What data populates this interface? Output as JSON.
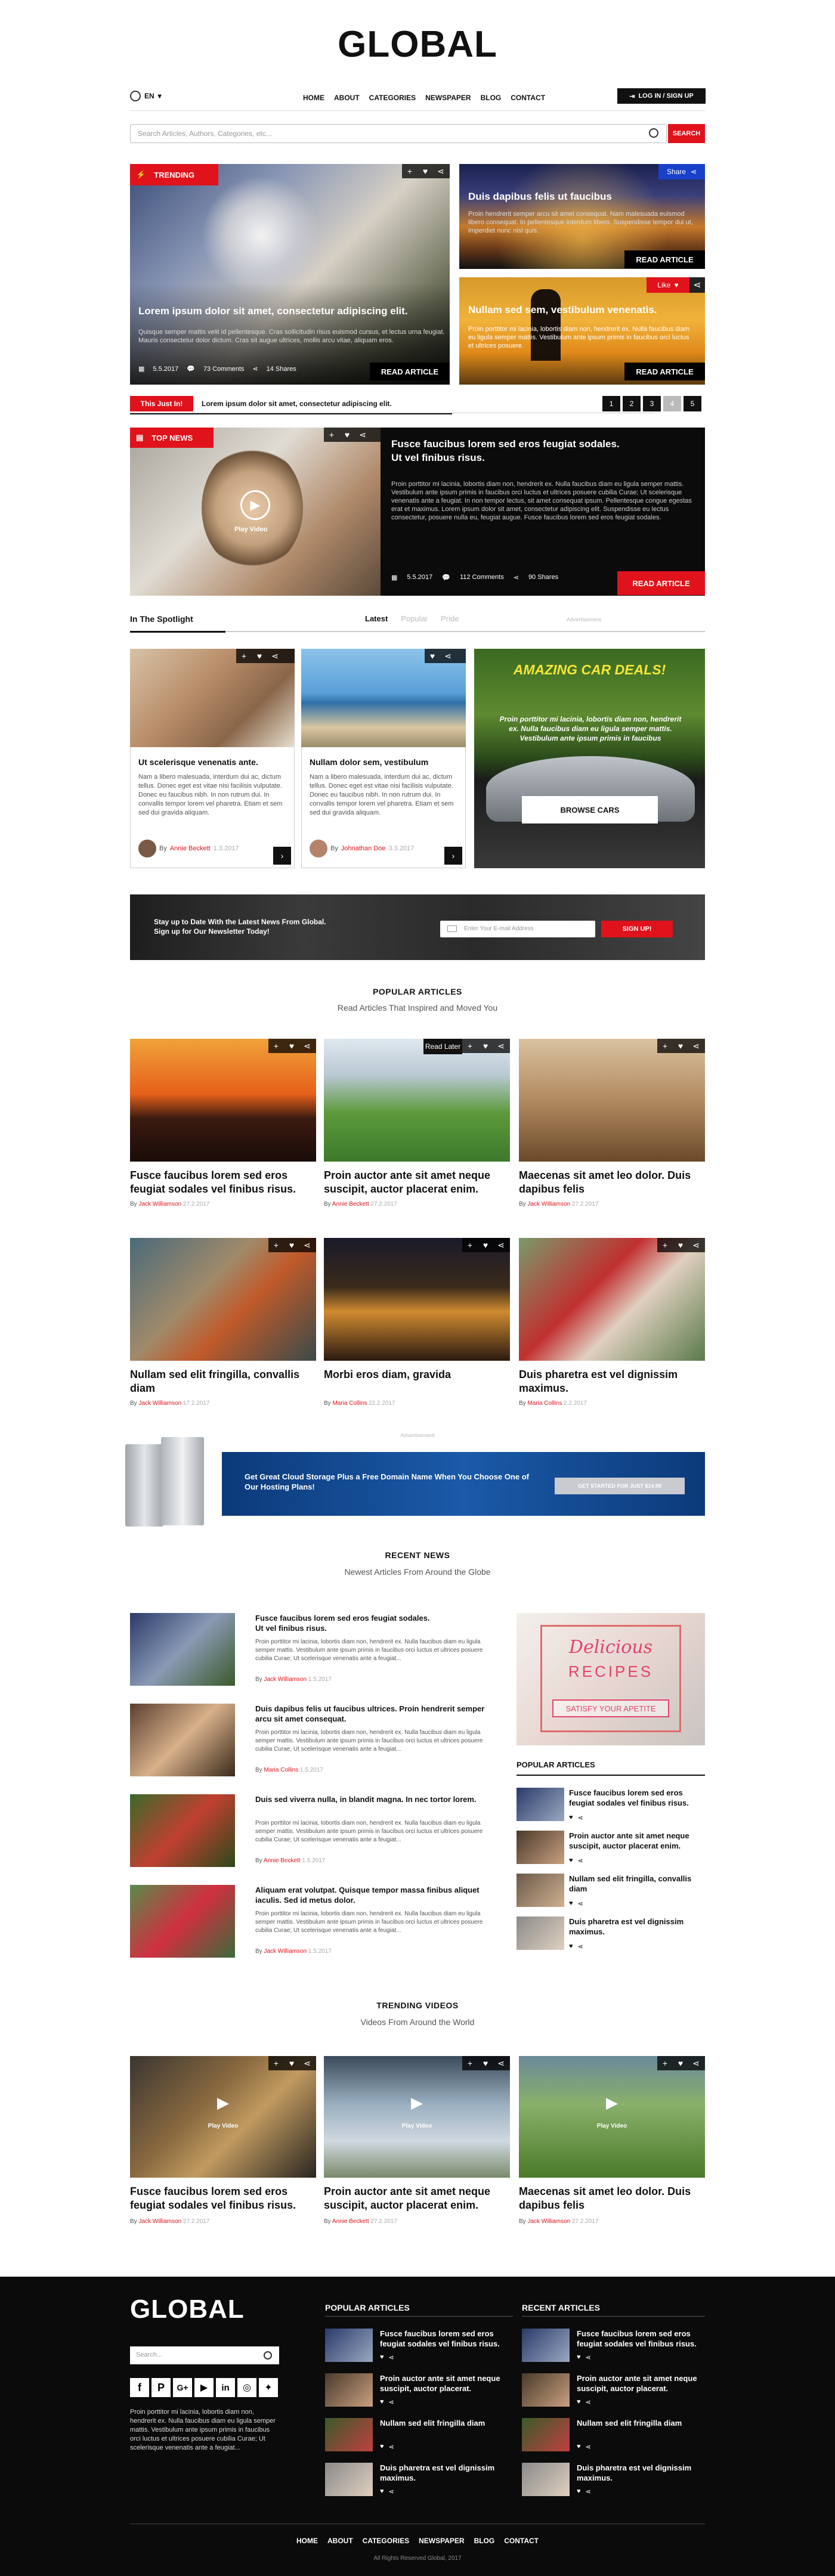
{
  "brand": {
    "logo": "GLOBAL"
  },
  "header": {
    "lang": "EN",
    "login": "LOG IN / SIGN UP",
    "search_placeholder": "Search Articles, Authors, Categories, etc...",
    "search_btn": "SEARCH",
    "nav": [
      "HOME",
      "ABOUT",
      "CATEGORIES",
      "NEWSPAPER",
      "BLOG",
      "CONTACT"
    ]
  },
  "trending": {
    "badge": "TRENDING",
    "main": {
      "title": "Lorem ipsum dolor sit amet, consectetur adipiscing elit.",
      "text": "Quisque semper mattis velit id pellentesque. Cras sollicitudin risus euismod cursus, et lectus urna feugiat. Mauris consectetur dolor dictum. Cras sit augue ultrices, mollis arcu vitae, aliquam eros.",
      "date": "5.5.2017",
      "comments": "73 Comments",
      "shares": "14 Shares",
      "read": "READ ARTICLE"
    },
    "side1": {
      "title": "Duis dapibus felis ut faucibus",
      "text": "Proin hendrerit semper arcu sit amet consequat. Nam malesuada euismod libero consequat. In pellentesque interdum libero. Suspendisse tempor dui ut, imperdiet nunc nisl quis.",
      "share": "Share",
      "read": "READ ARTICLE"
    },
    "side2": {
      "title": "Nullam sed sem, vestibulum venenatis.",
      "text": "Proin porttitor mi lacinia, lobortis diam non, hendrerit ex. Nulla faucibus diam eu ligula semper mattis. Vestibulum ante ipsum primis in faucibus orci luctus et ultrices posuere.",
      "like": "Like",
      "read": "READ ARTICLE"
    }
  },
  "ticker": {
    "label": "This Just In!",
    "text": "Lorem ipsum dolor sit amet, consectetur adipiscing elit.",
    "pages": [
      "1",
      "2",
      "3",
      "4",
      "5"
    ]
  },
  "top_news": {
    "badge": "TOP NEWS",
    "play": "Play Video",
    "title": "Fusce faucibus lorem sed eros feugiat sodales.\nUt vel finibus risus.",
    "text": "Proin porttitor mi lacinia, lobortis diam non, hendrerit ex. Nulla faucibus diam eu ligula semper mattis. Vestibulum ante ipsum primis in faucibus orci luctus et ultrices posuere cubilia Curae; Ut scelerisque venenatis ante a feugiat. In non tempor lectus, sit amet consequat ipsum. Pellentesque congue egestas erat et maximus. Lorem ipsum dolor sit amet, consectetur adipiscing elit. Suspendisse eu lectus consectetur, posuere nulla eu, feugiat augue. Fusce faucibus lorem sed eros feugiat sodales.",
    "date": "5.5.2017",
    "comments": "112 Comments",
    "shares": "90 Shares",
    "read": "READ ARTICLE"
  },
  "spotlight": {
    "heading": "In The Spotlight",
    "tabs": [
      "Latest",
      "Popular",
      "Pride"
    ],
    "ad_label": "Advertisement",
    "cards": [
      {
        "title": "Ut scelerisque venenatis ante.",
        "text": "Nam a libero malesuada, interdum dui ac, dictum tellus. Donec eget est vitae nisi facilisis vulputate. Donec eu faucibus nibh. In non rutrum dui. In convallis tempor lorem vel pharetra. Etiam et sem sed dui gravida aliquam.",
        "by": "By",
        "author": "Annie Beckett",
        "date": "1.3.2017"
      },
      {
        "title": "Nullam dolor sem, vestibulum",
        "text": "Nam a libero malesuada, interdum dui ac, dictum tellus. Donec eget est vitae nisi facilisis vulputate. Donec eu faucibus nibh. In non rutrum dui. In convallis tempor lorem vel pharetra. Etiam et sem sed dui gravida aliquam.",
        "by": "By",
        "author": "Johnathan Doe",
        "date": "3.3.2017"
      }
    ],
    "car_ad": {
      "title": "AMAZING CAR DEALS!",
      "text": "Proin porttitor mi lacinia, lobortis diam non, hendrerit ex. Nulla faucibus diam eu ligula semper mattis. Vestibulum ante ipsum primis in faucibus",
      "btn": "BROWSE CARS"
    }
  },
  "newsletter": {
    "text": "Stay up to Date With the Latest News From Global.\nSign up for Our Newsletter Today!",
    "placeholder": "Enter Your E-mail Address",
    "btn": "SIGN UP!"
  },
  "popular": {
    "title": "POPULAR ARTICLES",
    "sub": "Read Articles That Inspired and Moved You",
    "read_later": "Read Later",
    "items": [
      {
        "title": "Fusce faucibus lorem sed eros feugiat sodales vel finibus risus.",
        "author": "Jack Williamson",
        "date": "27.2.2017"
      },
      {
        "title": "Proin auctor ante sit amet neque suscipit, auctor placerat enim.",
        "author": "Annie Beckett",
        "date": "27.2.2017"
      },
      {
        "title": "Maecenas sit amet leo dolor. Duis dapibus felis",
        "author": "Jack Williamson",
        "date": "27.2.2017"
      },
      {
        "title": "Nullam sed elit fringilla, convallis diam",
        "author": "Jack Williamson",
        "date": "17.2.2017"
      },
      {
        "title": "Morbi eros diam, gravida",
        "author": "Maria Collins",
        "date": "22.2.2017"
      },
      {
        "title": "Duis pharetra est vel dignissim maximus.",
        "author": "Maria Collins",
        "date": "2.2.2017"
      }
    ]
  },
  "hosting": {
    "ad_label": "Advertisement",
    "text": "Get Great Cloud Storage Plus a Free Domain Name When You Choose One of Our Hosting Plans!",
    "btn": "GET STARTED FOR JUST $14.99"
  },
  "recent": {
    "title": "RECENT NEWS",
    "sub": "Newest Articles From Around the Globe",
    "items": [
      {
        "title": "Fusce faucibus lorem sed eros feugiat sodales.\nUt vel finibus risus.",
        "text": "Proin porttitor mi lacinia, lobortis diam non, hendrerit ex. Nulla faucibus diam eu ligula semper mattis. Vestibulum ante ipsum primis in faucibus orci luctus et ultrices posuere cubilia Curae; Ut scelerisque venenatis ante a feugiat...",
        "author": "Jack Williamson",
        "date": "1.5.2017"
      },
      {
        "title": "Duis dapibus felis ut faucibus ultrices. Proin hendrerit semper arcu sit amet consequat.",
        "text": "Proin porttitor mi lacinia, lobortis diam non, hendrerit ex. Nulla faucibus diam eu ligula semper mattis. Vestibulum ante ipsum primis in faucibus orci luctus et ultrices posuere cubilia Curae; Ut scelerisque venenatis ante a feugiat...",
        "author": "Maria Collins",
        "date": "1.5.2017"
      },
      {
        "title": "Duis sed viverra nulla, in blandit magna. In nec tortor lorem.",
        "text": "Proin porttitor mi lacinia, lobortis diam non, hendrerit ex. Nulla faucibus diam eu ligula semper mattis. Vestibulum ante ipsum primis in faucibus orci luctus et ultrices posuere cubilia Curae; Ut scelerisque venenatis ante a feugiat...",
        "author": "Annie Beckett",
        "date": "1.5.2017"
      },
      {
        "title": "Aliquam erat volutpat. Quisque tempor massa finibus aliquet iaculis. Sed id metus dolor.",
        "text": "Proin porttitor mi lacinia, lobortis diam non, hendrerit ex. Nulla faucibus diam eu ligula semper mattis. Vestibulum ante ipsum primis in faucibus orci luctus et ultrices posuere cubilia Curae; Ut scelerisque venenatis ante a feugiat...",
        "author": "Jack Williamson",
        "date": "1.5.2017"
      }
    ],
    "side_ad": {
      "line1": "Delicious",
      "line2": "RECIPES",
      "line3": "SATISFY YOUR APETITE"
    },
    "side_popular": {
      "title": "POPULAR ARTICLES",
      "items": [
        "Fusce faucibus lorem sed eros feugiat sodales vel finibus risus.",
        "Proin auctor ante sit amet neque suscipit, auctor placerat enim.",
        "Nullam sed elit fringilla, convallis diam",
        "Duis pharetra est vel dignissim maximus."
      ]
    }
  },
  "videos": {
    "title": "TRENDING VIDEOS",
    "sub": "Videos From Around the World",
    "play": "Play Video",
    "items": [
      {
        "title": "Fusce faucibus lorem sed eros feugiat sodales vel finibus risus.",
        "author": "Jack Williamson",
        "date": "27.2.2017"
      },
      {
        "title": "Proin auctor ante sit amet neque suscipit, auctor placerat enim.",
        "author": "Annie Beckett",
        "date": "27.2.2017"
      },
      {
        "title": "Maecenas sit amet leo dolor. Duis dapibus felis",
        "author": "Jack Williamson",
        "date": "27.2.2017"
      }
    ]
  },
  "footer": {
    "logo": "GLOBAL",
    "search_placeholder": "Search...",
    "about": "Proin porttitor mi lacinia, lobortis diam non, hendrerit ex. Nulla faucibus diam eu ligula semper mattis. Vestibulum ante ipsum primis in faucibus orci luctus et ultrices posuere cubilia Curae; Ut scelerisque venenatis ante a feugiat...",
    "popular_title": "POPULAR ARTICLES",
    "recent_title": "RECENT ARTICLES",
    "popular": [
      "Fusce faucibus lorem sed eros feugiat sodales vel finibus risus.",
      "Proin auctor ante sit amet neque suscipit, auctor placerat.",
      "Nullam sed elit fringilla diam",
      "Duis pharetra est vel dignissim maximus."
    ],
    "recent": [
      "Fusce faucibus lorem sed eros feugiat sodales vel finibus risus.",
      "Proin auctor ante sit amet neque suscipit, auctor placerat.",
      "Nullam sed elit fringilla diam",
      "Duis pharetra est vel dignissim maximus."
    ],
    "nav": [
      "HOME",
      "ABOUT",
      "CATEGORIES",
      "NEWSPAPER",
      "BLOG",
      "CONTACT"
    ],
    "copyright": "All Rights Reserved Global, 2017"
  },
  "colors": {
    "accent": "#e0121b",
    "dark": "#0b0b0b"
  }
}
